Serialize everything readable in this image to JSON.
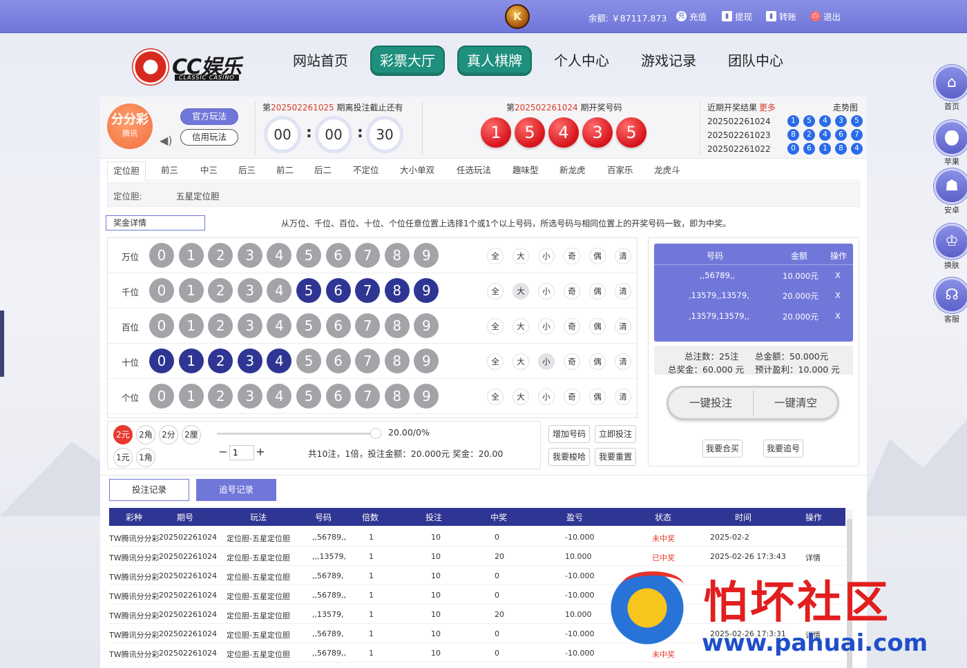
{
  "topbar": {
    "medal": "K",
    "balance": "余额: ￥87117.873",
    "links": [
      {
        "icon": "充",
        "label": "充值",
        "name": "recharge"
      },
      {
        "icon": "▮",
        "label": "提现",
        "name": "withdraw"
      },
      {
        "icon": "▮",
        "label": "转账",
        "name": "transfer"
      },
      {
        "icon": "⏻",
        "label": "退出",
        "name": "logout"
      }
    ]
  },
  "logo": {
    "brand": "CC娱乐",
    "sub": "CLASSIC CASINO"
  },
  "nav": [
    "网站首页",
    "彩票大厅",
    "真人棋牌",
    "个人中心",
    "游戏记录",
    "团队中心"
  ],
  "nav_active": [
    "彩票大厅",
    "真人棋牌"
  ],
  "sidenav": [
    {
      "icon": "⌂",
      "label": "首页"
    },
    {
      "icon": "",
      "label": "苹果"
    },
    {
      "icon": "☗",
      "label": "安卓"
    },
    {
      "icon": "♔",
      "label": "换肤"
    },
    {
      "icon": "☊",
      "label": "客服"
    }
  ],
  "lottery": {
    "icon_title": "分分彩",
    "icon_sub": "腾讯",
    "play_official": "官方玩法",
    "play_credit": "信用玩法",
    "countdown_prefix": "第",
    "countdown_issue": "202502261025",
    "countdown_suffix": " 期离投注截止还有",
    "timer": [
      "00",
      "00",
      "30"
    ],
    "draw_prefix": "第",
    "draw_issue": "202502261024",
    "draw_suffix": " 期开奖号码",
    "draw_balls": [
      "1",
      "5",
      "4",
      "3",
      "5"
    ],
    "recent_title": "近期开奖结果",
    "recent_more": "更多",
    "trend": "走势图",
    "recent": [
      {
        "issue": "202502261024",
        "balls": [
          "1",
          "5",
          "4",
          "3",
          "5"
        ]
      },
      {
        "issue": "202502261023",
        "balls": [
          "8",
          "2",
          "4",
          "6",
          "7"
        ]
      },
      {
        "issue": "202502261022",
        "balls": [
          "0",
          "6",
          "1",
          "8",
          "4"
        ]
      }
    ]
  },
  "tabs": [
    "定位胆",
    "前三",
    "中三",
    "后三",
    "前二",
    "后二",
    "不定位",
    "大小单双",
    "任选玩法",
    "趣味型",
    "新龙虎",
    "百家乐",
    "龙虎斗"
  ],
  "subbar": {
    "label": "定位胆:",
    "value": "五星定位胆"
  },
  "rule": {
    "button": "奖金详情",
    "text": "从万位、千位、百位、十位、个位任意位置上选择1个或1个以上号码，所选号码与相同位置上的开奖号码一致，即为中奖。"
  },
  "grid": {
    "rows": [
      {
        "pos": "万位",
        "selected": []
      },
      {
        "pos": "千位",
        "selected": [
          5,
          6,
          7,
          8,
          9
        ]
      },
      {
        "pos": "百位",
        "selected": []
      },
      {
        "pos": "十位",
        "selected": [
          0,
          1,
          2,
          3,
          4
        ]
      },
      {
        "pos": "个位",
        "selected": []
      }
    ],
    "digits": [
      "0",
      "1",
      "2",
      "3",
      "4",
      "5",
      "6",
      "7",
      "8",
      "9"
    ],
    "filters": [
      "全",
      "大",
      "小",
      "奇",
      "偶",
      "清"
    ],
    "filter_selected": [
      [],
      [
        "大"
      ],
      [],
      [
        "小"
      ],
      []
    ]
  },
  "config": {
    "units": [
      "2元",
      "2角",
      "2分",
      "2厘",
      "1元",
      "1角"
    ],
    "unit_selected": "2元",
    "slider_value": "20.00/0%",
    "multiplier": "1",
    "summary": "共10注，1倍，投注金额：20.000元  奖金：20.00",
    "buttons": [
      "增加号码",
      "立即投注",
      "我要梭哈",
      "我要重置"
    ]
  },
  "cart": {
    "headers": [
      "号码",
      "金额",
      "操作"
    ],
    "rows": [
      {
        "code": ",,56789,,",
        "amount": "10.000元",
        "op": "X"
      },
      {
        "code": ",13579,,13579,",
        "amount": "20.000元",
        "op": "X"
      },
      {
        "code": ",13579,13579,,",
        "amount": "20.000元",
        "op": "X"
      }
    ],
    "total_bets": "总注数：25注",
    "total_amount": "总金额：50.000元",
    "total_prize": "总奖金：60.000 元",
    "expected_profit": "预计盈利：10.000 元",
    "one_click_bet": "一键投注",
    "one_click_clear": "一键清空",
    "group_buy": "我要合买",
    "chase": "我要追号"
  },
  "records": {
    "tab_bet": "投注记录",
    "tab_chase": "追号记录",
    "headers": [
      "彩种",
      "期号",
      "玩法",
      "号码",
      "倍数",
      "投注",
      "中奖",
      "盈亏",
      "状态",
      "时间",
      "操作"
    ],
    "rows": [
      {
        "lottery": "TW腾讯分分彩",
        "issue": "202502261024",
        "play": "定位胆-五星定位胆",
        "code": ",,56789,,",
        "mult": "1",
        "bet": "10",
        "win": "0",
        "pl": "-10.000",
        "status": "未中奖",
        "time": "2025-02-2",
        "op": ""
      },
      {
        "lottery": "TW腾讯分分彩",
        "issue": "202502261024",
        "play": "定位胆-五星定位胆",
        "code": ",,,13579,",
        "mult": "1",
        "bet": "10",
        "win": "20",
        "pl": "10.000",
        "status": "已中奖",
        "time": "2025-02-26 17:3:43",
        "op": "详情"
      },
      {
        "lottery": "TW腾讯分分彩",
        "issue": "202502261024",
        "play": "定位胆-五星定位胆",
        "code": ",,56789,",
        "mult": "1",
        "bet": "10",
        "win": "0",
        "pl": "-10.000",
        "status": "",
        "time": "",
        "op": ""
      },
      {
        "lottery": "TW腾讯分分彩",
        "issue": "202502261024",
        "play": "定位胆-五星定位胆",
        "code": ",,56789,,",
        "mult": "1",
        "bet": "10",
        "win": "0",
        "pl": "-10.000",
        "status": "",
        "time": "",
        "op": ""
      },
      {
        "lottery": "TW腾讯分分彩",
        "issue": "202502261024",
        "play": "定位胆-五星定位胆",
        "code": ",,13579,",
        "mult": "1",
        "bet": "10",
        "win": "20",
        "pl": "10.000",
        "status": "",
        "time": "",
        "op": ""
      },
      {
        "lottery": "TW腾讯分分彩",
        "issue": "202502261024",
        "play": "定位胆-五星定位胆",
        "code": ",,56789,",
        "mult": "1",
        "bet": "10",
        "win": "0",
        "pl": "-10.000",
        "status": "",
        "time": "2025-02-26 17:3:31",
        "op": "详情"
      },
      {
        "lottery": "TW腾讯分分彩",
        "issue": "202502261024",
        "play": "定位胆-五星定位胆",
        "code": ",,56789,,",
        "mult": "1",
        "bet": "10",
        "win": "0",
        "pl": "-10.000",
        "status": "未中奖",
        "time": "",
        "op": ""
      }
    ]
  },
  "watermark": {
    "title": "怕坏社区",
    "url": "www.pahuai.com"
  },
  "colors": {
    "accent": "#7177d9",
    "navy": "#2f3592",
    "red": "#e8392f",
    "teal": "#1f8f7e"
  }
}
